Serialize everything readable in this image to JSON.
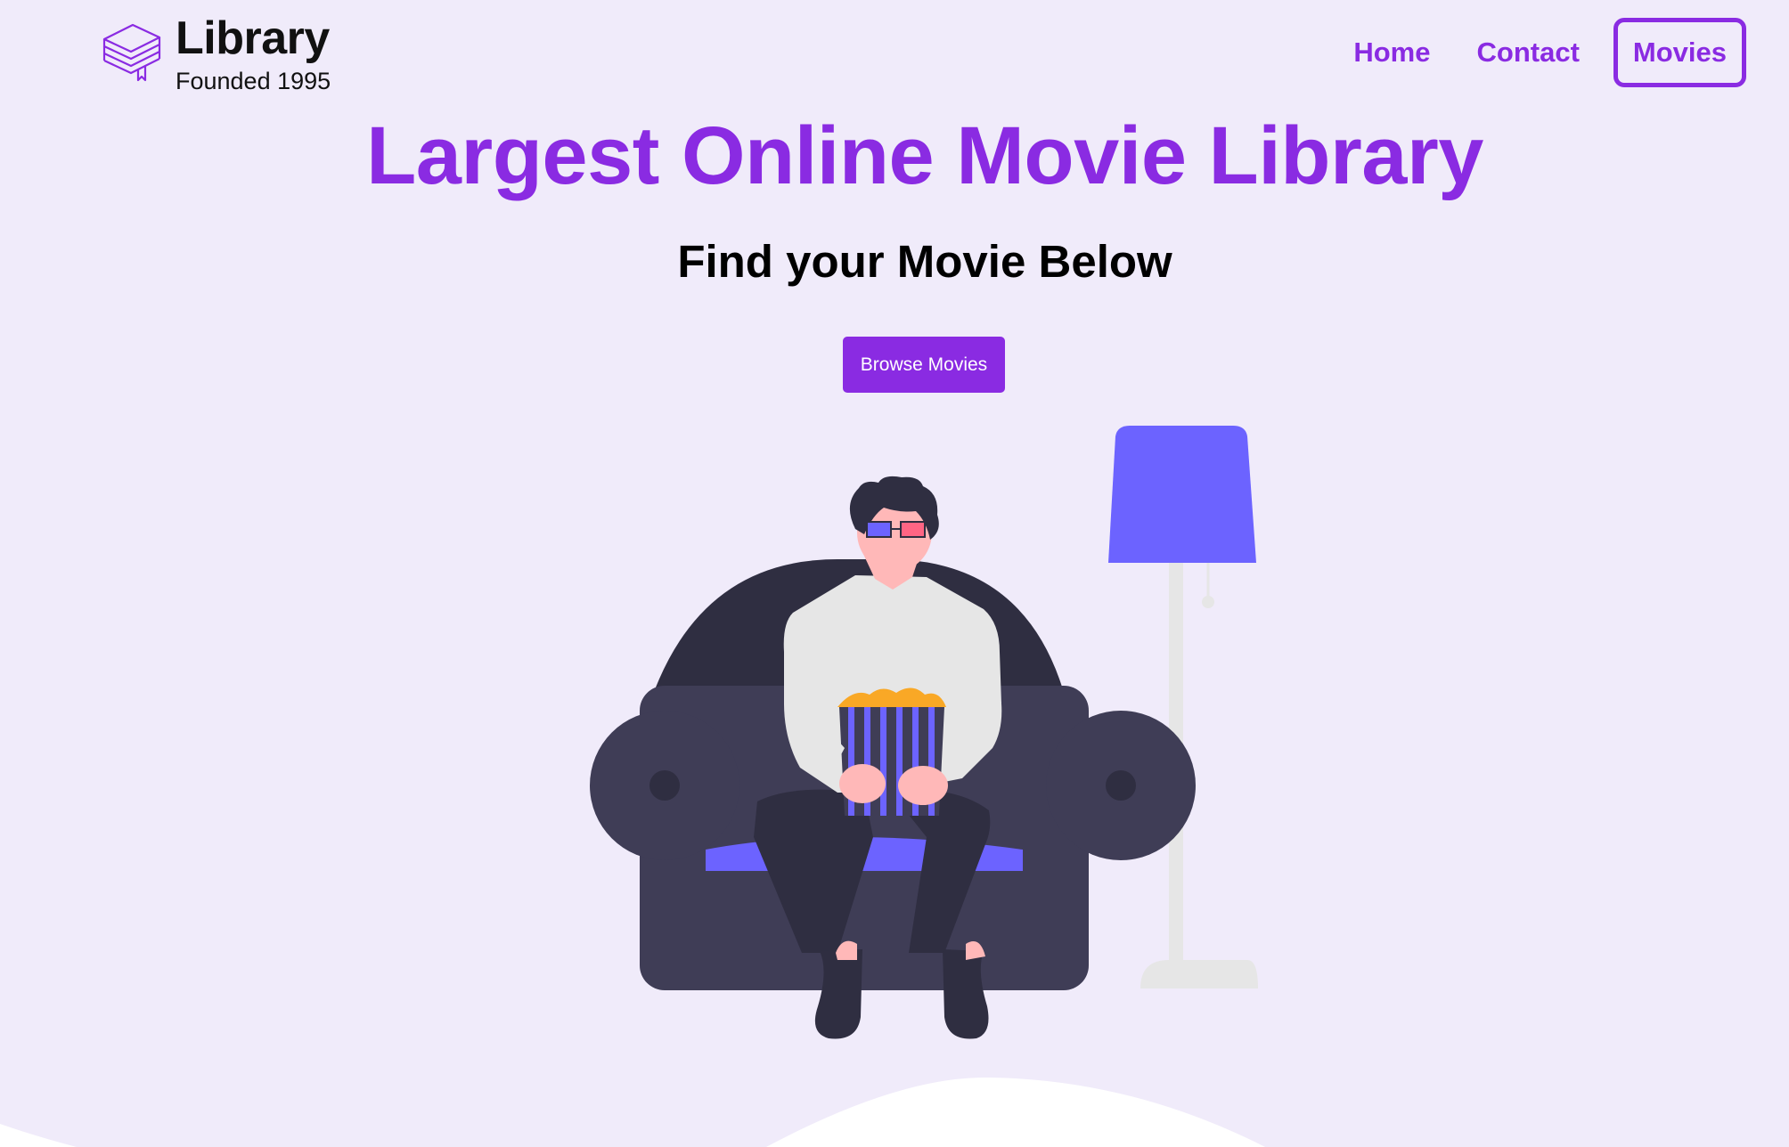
{
  "header": {
    "logo_title": "Library",
    "logo_subtitle": "Founded 1995",
    "logo_icon": "stacked-books-icon"
  },
  "nav": {
    "items": [
      {
        "label": "Home",
        "active": false
      },
      {
        "label": "Contact",
        "active": false
      },
      {
        "label": "Movies",
        "active": true
      }
    ]
  },
  "hero": {
    "title": "Largest Online Movie Library",
    "subtitle": "Find your Movie Below",
    "cta_label": "Browse Movies",
    "illustration": "person-watching-movie-illustration"
  },
  "colors": {
    "background": "#f0ebfa",
    "accent": "#8a2be2",
    "sofa": "#3f3d56",
    "lamp_shade": "#6c63ff",
    "popcorn": "#f9a826"
  }
}
